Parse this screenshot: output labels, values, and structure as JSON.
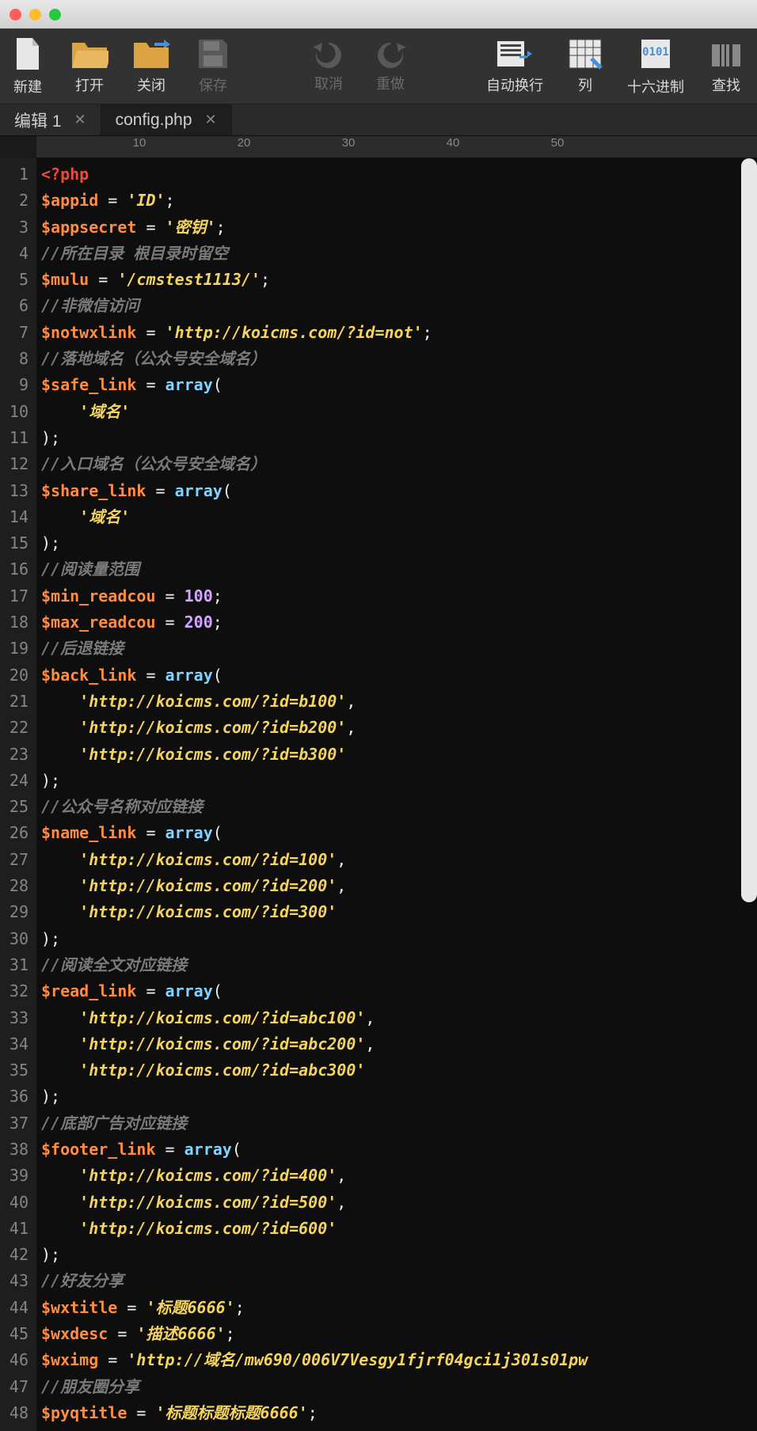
{
  "toolbar": {
    "new": "新建",
    "open": "打开",
    "close": "关闭",
    "save": "保存",
    "undo": "取消",
    "redo": "重做",
    "wrap": "自动换行",
    "column": "列",
    "hex": "十六进制",
    "find": "查找",
    "hex_icon_text": "0101"
  },
  "tabs": {
    "t1": "编辑 1",
    "t2": "config.php"
  },
  "ruler": {
    "n10": "10",
    "n20": "20",
    "n30": "30",
    "n40": "40",
    "n50": "50"
  },
  "lines": {
    "l1": "1",
    "l2": "2",
    "l3": "3",
    "l4": "4",
    "l5": "5",
    "l6": "6",
    "l7": "7",
    "l8": "8",
    "l9": "9",
    "l10": "10",
    "l11": "11",
    "l12": "12",
    "l13": "13",
    "l14": "14",
    "l15": "15",
    "l16": "16",
    "l17": "17",
    "l18": "18",
    "l19": "19",
    "l20": "20",
    "l21": "21",
    "l22": "22",
    "l23": "23",
    "l24": "24",
    "l25": "25",
    "l26": "26",
    "l27": "27",
    "l28": "28",
    "l29": "29",
    "l30": "30",
    "l31": "31",
    "l32": "32",
    "l33": "33",
    "l34": "34",
    "l35": "35",
    "l36": "36",
    "l37": "37",
    "l38": "38",
    "l39": "39",
    "l40": "40",
    "l41": "41",
    "l42": "42",
    "l43": "43",
    "l44": "44",
    "l45": "45",
    "l46": "46",
    "l47": "47",
    "l48": "48"
  },
  "code": {
    "php_open": "<?php",
    "var_appid": "$appid",
    "str_id": "'ID'",
    "var_appsecret": "$appsecret",
    "str_secret": "'密钥'",
    "com_dir": "//所在目录 根目录时留空",
    "var_mulu": "$mulu",
    "str_mulu": "'/cmstest1113/'",
    "com_notwx": "//非微信访问",
    "var_notwxlink": "$notwxlink",
    "str_notwx": "'http://koicms.com/?id=not'",
    "com_safe": "//落地域名（公众号安全域名）",
    "var_safelink": "$safe_link",
    "kw_array": "array",
    "str_domain": "'域名'",
    "com_share": "//入口域名（公众号安全域名）",
    "var_sharelink": "$share_link",
    "com_read": "//阅读量范围",
    "var_minread": "$min_readcou",
    "num_100": "100",
    "var_maxread": "$max_readcou",
    "num_200": "200",
    "com_back": "//后退链接",
    "var_backlink": "$back_link",
    "str_b100": "'http://koicms.com/?id=b100'",
    "str_b200": "'http://koicms.com/?id=b200'",
    "str_b300": "'http://koicms.com/?id=b300'",
    "com_name": "//公众号名称对应链接",
    "var_namelink": "$name_link",
    "str_n100": "'http://koicms.com/?id=100'",
    "str_n200": "'http://koicms.com/?id=200'",
    "str_n300": "'http://koicms.com/?id=300'",
    "com_readfull": "//阅读全文对应链接",
    "var_readlink": "$read_link",
    "str_abc100": "'http://koicms.com/?id=abc100'",
    "str_abc200": "'http://koicms.com/?id=abc200'",
    "str_abc300": "'http://koicms.com/?id=abc300'",
    "com_footer": "//底部广告对应链接",
    "var_footerlink": "$footer_link",
    "str_f400": "'http://koicms.com/?id=400'",
    "str_f500": "'http://koicms.com/?id=500'",
    "str_f600": "'http://koicms.com/?id=600'",
    "com_friend": "//好友分享",
    "var_wxtitle": "$wxtitle",
    "str_wxtitle": "'标题6666'",
    "var_wxdesc": "$wxdesc",
    "str_wxdesc": "'描述6666'",
    "var_wximg": "$wximg",
    "str_wximg": "'http://域名/mw690/006V7Vesgy1fjrf04gci1j301s01pw",
    "com_pyq": "//朋友圈分享",
    "var_pyqtitle": "$pyqtitle",
    "str_pyqtitle": "'标题标题标题6666'",
    "eq": " = ",
    "semi": ";",
    "comma": ",",
    "lparen": "(",
    "rparen": ")",
    "rparen_semi": ");",
    "indent": "    "
  }
}
